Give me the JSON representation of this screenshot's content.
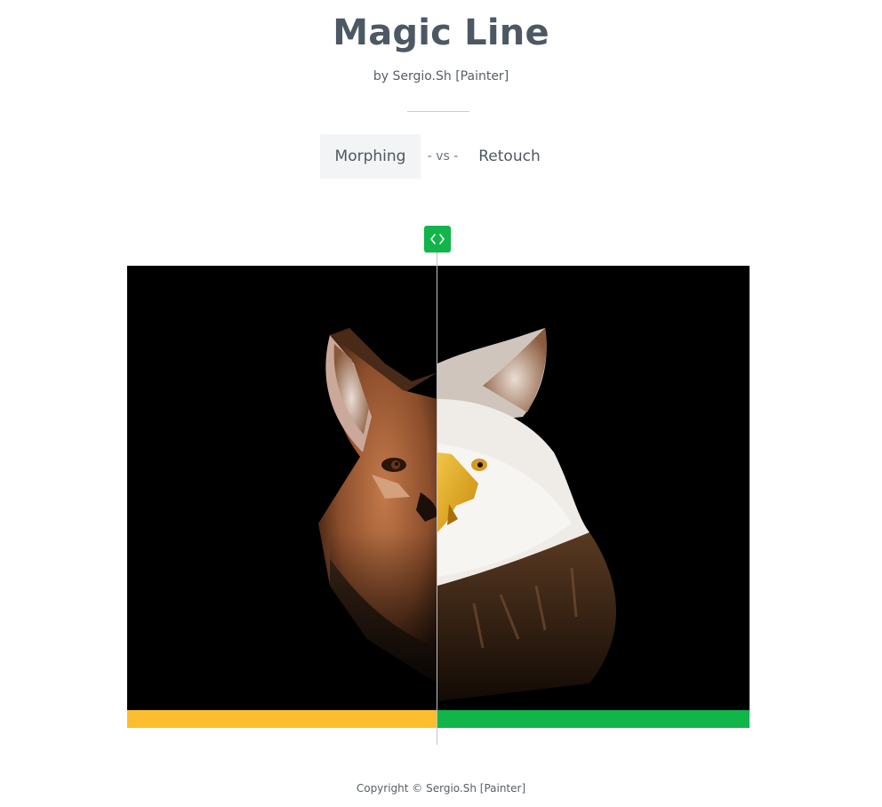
{
  "header": {
    "title": "Magic Line",
    "byline": "by Sergio.Sh [Painter]"
  },
  "tabs": [
    {
      "label": "Morphing",
      "active": true
    },
    {
      "label": "Retouch",
      "active": false
    }
  ],
  "tabs_separator": "- vs -",
  "comparer": {
    "handle_icon": "left-right-arrows-icon",
    "left_image": "fox-portrait",
    "right_image": "bald-eagle-portrait",
    "split_fraction": 0.5,
    "left_bar_color": "#fbbe2e",
    "right_bar_color": "#11b549"
  },
  "footer": {
    "copyright": "Copyright © Sergio.Sh [Painter]"
  }
}
